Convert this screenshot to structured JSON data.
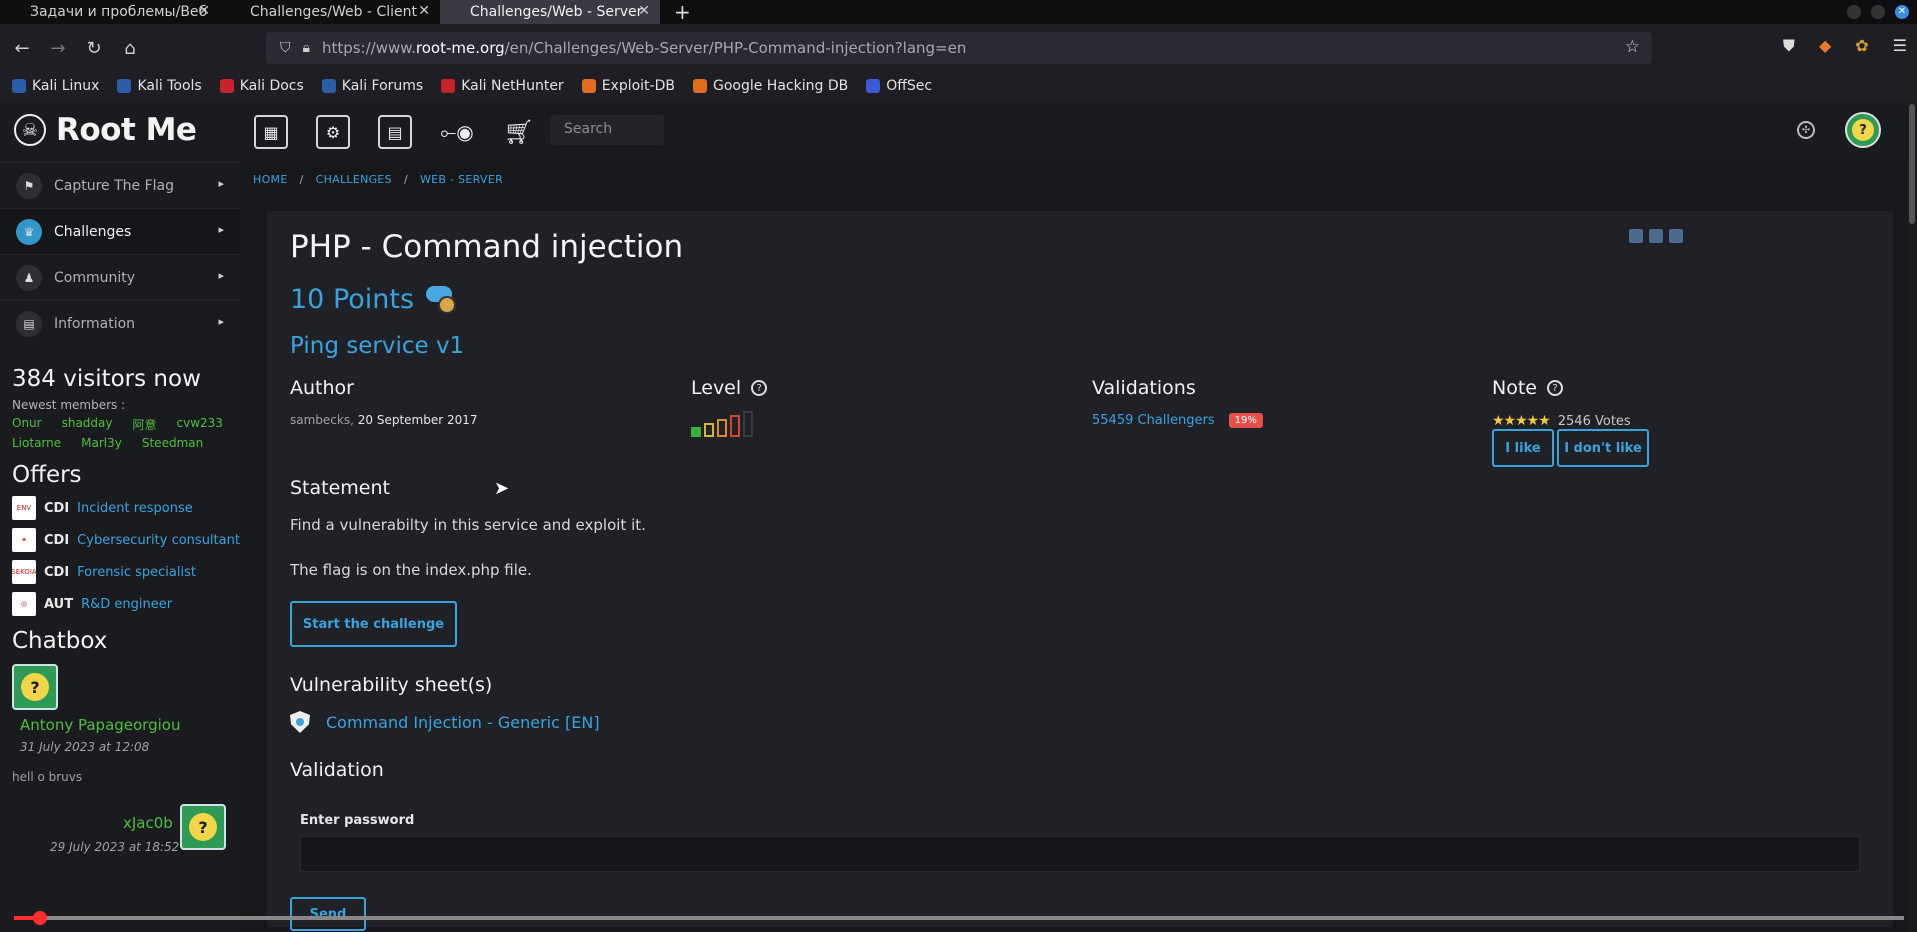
{
  "browser": {
    "tabs": [
      {
        "label": "Задачи и проблемы/Веб",
        "active": false
      },
      {
        "label": "Challenges/Web - Client",
        "active": false
      },
      {
        "label": "Challenges/Web - Server",
        "active": true
      }
    ],
    "url_prefix": "https://www.",
    "url_domain": "root-me.org",
    "url_path": "/en/Challenges/Web-Server/PHP-Command-injection?lang=en",
    "bookmarks": [
      {
        "label": "Kali Linux",
        "color": "#2a5fa8"
      },
      {
        "label": "Kali Tools",
        "color": "#2a5fa8"
      },
      {
        "label": "Kali Docs",
        "color": "#c8232c"
      },
      {
        "label": "Kali Forums",
        "color": "#2a5fa8"
      },
      {
        "label": "Kali NetHunter",
        "color": "#c8232c"
      },
      {
        "label": "Exploit-DB",
        "color": "#e06c1d"
      },
      {
        "label": "Google Hacking DB",
        "color": "#e06c1d"
      },
      {
        "label": "OffSec",
        "color": "#3a5ad8"
      }
    ]
  },
  "site": {
    "logo": "Root Me",
    "search_placeholder": "Search",
    "menu": [
      {
        "label": "Capture The Flag",
        "active": false
      },
      {
        "label": "Challenges",
        "active": true
      },
      {
        "label": "Community",
        "active": false
      },
      {
        "label": "Information",
        "active": false
      }
    ],
    "visitors": "384 visitors now",
    "newest_label": "Newest members :",
    "members": [
      "Onur",
      "shadday",
      "阿意",
      "cvw233",
      "Liotarne",
      "Marl3y",
      "Steedman"
    ],
    "offers_title": "Offers",
    "offers": [
      {
        "badge": "ENV",
        "kind": "CDI",
        "title": "Incident response"
      },
      {
        "badge": "✦",
        "kind": "CDI",
        "title": "Cybersecurity consultant"
      },
      {
        "badge": "SEKOIA",
        "kind": "CDI",
        "title": "Forensic specialist"
      },
      {
        "badge": "◎",
        "kind": "AUT",
        "title": "R&D engineer"
      }
    ],
    "chatbox_title": "Chatbox",
    "chat": [
      {
        "name": "Antony Papageorgiou",
        "date": "31 July 2023 at 12:08",
        "message": "hell o bruvs"
      },
      {
        "name": "xJac0b",
        "date": "29 July 2023 at 18:52"
      }
    ]
  },
  "breadcrumb": [
    "HOME",
    "CHALLENGES",
    "WEB - SERVER"
  ],
  "challenge": {
    "title": "PHP - Command injection",
    "points": "10 Points",
    "subtitle": "Ping service v1",
    "author_label": "Author",
    "author": "sambecks,",
    "date": "20 September 2017",
    "level_label": "Level",
    "level": 1,
    "level_max": 5,
    "validations_label": "Validations",
    "challengers": "55459 Challengers",
    "percent": "19%",
    "note_label": "Note",
    "rating": 5,
    "votes": "2546 Votes",
    "like": "I like",
    "dislike": "I don't like",
    "statement_label": "Statement",
    "statement_1": "Find a vulnerabilty in this service and exploit it.",
    "statement_2": "The flag is on the index.php file.",
    "start": "Start the challenge",
    "vuln_label": "Vulnerability sheet(s)",
    "vuln_link": "Command Injection - Generic [EN]",
    "validation_label": "Validation",
    "password_label": "Enter password",
    "send": "Send"
  },
  "video": {
    "progress": 0.014
  }
}
